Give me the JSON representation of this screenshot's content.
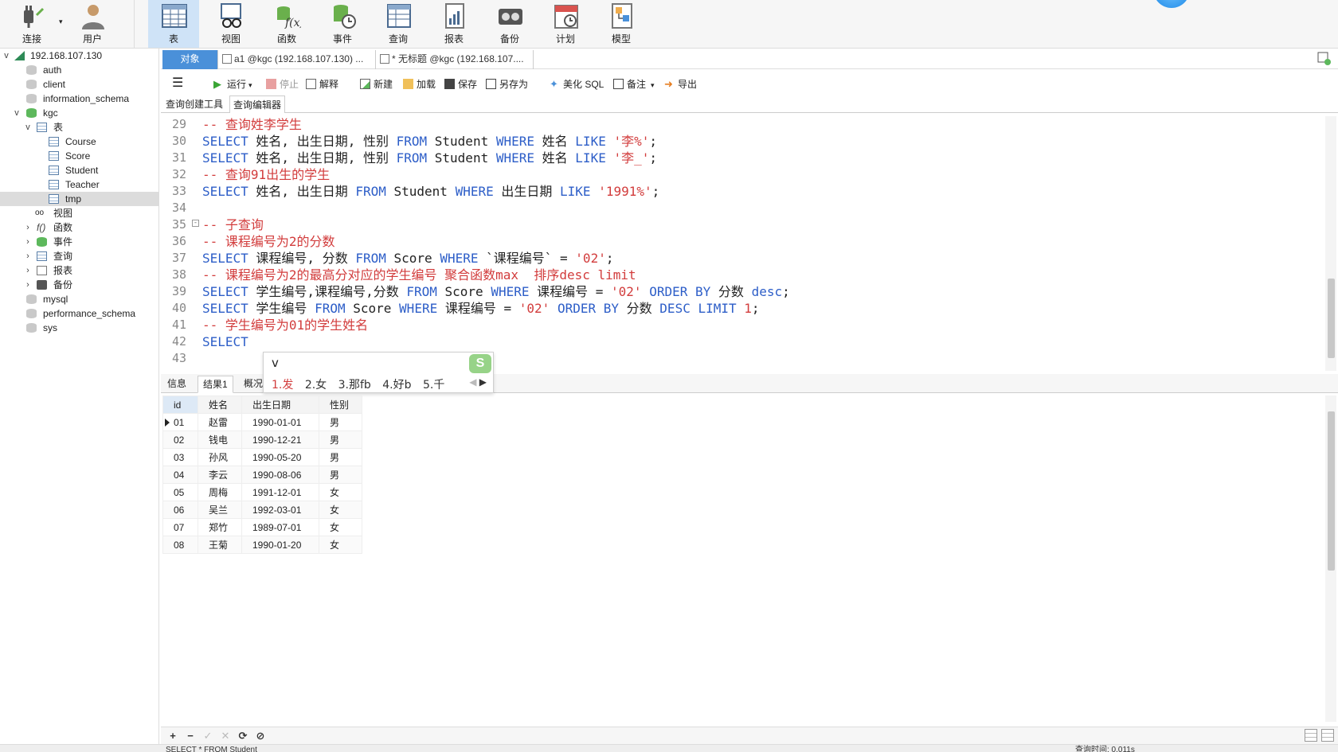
{
  "toolbar": {
    "buttons": [
      {
        "label": "连接"
      },
      {
        "label": "用户"
      },
      {
        "label": "表"
      },
      {
        "label": "视图"
      },
      {
        "label": "函数"
      },
      {
        "label": "事件"
      },
      {
        "label": "查询"
      },
      {
        "label": "报表"
      },
      {
        "label": "备份"
      },
      {
        "label": "计划"
      },
      {
        "label": "模型"
      }
    ]
  },
  "sidebar": {
    "connection": "192.168.107.130",
    "databases_top": [
      "auth",
      "client",
      "information_schema"
    ],
    "kgc": {
      "name": "kgc",
      "tables_label": "表",
      "tables": [
        "Course",
        "Score",
        "Student",
        "Teacher",
        "tmp"
      ],
      "selected_table": "tmp",
      "groups": [
        "视图",
        "函数",
        "事件",
        "查询",
        "报表",
        "备份"
      ]
    },
    "databases_bottom": [
      "mysql",
      "performance_schema",
      "sys"
    ]
  },
  "tabs": [
    {
      "label": "对象"
    },
    {
      "label": "a1 @kgc (192.168.107.130) ..."
    },
    {
      "label": "* 无标题 @kgc (192.168.107...."
    }
  ],
  "query_toolbar": {
    "run": "运行",
    "stop": "停止",
    "explain": "解释",
    "new": "新建",
    "load": "加载",
    "save": "保存",
    "save_as": "另存为",
    "beautify": "美化 SQL",
    "comment": "备注",
    "export": "导出"
  },
  "subtabs": {
    "builder": "查询创建工具",
    "editor": "查询编辑器"
  },
  "editor": {
    "lines": [
      {
        "n": "29",
        "c": "-- 查询姓李学生"
      },
      {
        "n": "30",
        "c": "SELECT 姓名, 出生日期, 性别 FROM Student WHERE 姓名 LIKE '李%';"
      },
      {
        "n": "31",
        "c": "SELECT 姓名, 出生日期, 性别 FROM Student WHERE 姓名 LIKE '李_';"
      },
      {
        "n": "32",
        "c": "-- 查询91出生的学生"
      },
      {
        "n": "33",
        "c": "SELECT 姓名, 出生日期 FROM Student WHERE 出生日期 LIKE '1991%';"
      },
      {
        "n": "34",
        "c": ""
      },
      {
        "n": "35",
        "c": "-- 子查询"
      },
      {
        "n": "36",
        "c": "-- 课程编号为2的分数"
      },
      {
        "n": "37",
        "c": "SELECT 课程编号, 分数 FROM Score WHERE `课程编号` = '02';"
      },
      {
        "n": "38",
        "c": "-- 课程编号为2的最高分对应的学生编号 聚合函数max  排序desc limit"
      },
      {
        "n": "39",
        "c": "SELECT 学生编号,课程编号,分数 FROM Score WHERE 课程编号 = '02' ORDER BY 分数 desc;"
      },
      {
        "n": "40",
        "c": "SELECT 学生编号 FROM Score WHERE 课程编号 = '02' ORDER BY 分数 DESC LIMIT 1;"
      },
      {
        "n": "41",
        "c": "-- 学生编号为01的学生姓名"
      },
      {
        "n": "42",
        "c": "SELECT"
      },
      {
        "n": "43",
        "c": ""
      }
    ]
  },
  "ime": {
    "input": "v",
    "logo": "S",
    "candidates": [
      "1.发",
      "2.女",
      "3.那fb",
      "4.好b",
      "5.千"
    ]
  },
  "result_tabs": {
    "info": "信息",
    "result1": "结果1",
    "profile": "概况"
  },
  "result": {
    "columns": [
      "id",
      "姓名",
      "出生日期",
      "性别"
    ],
    "rows": [
      [
        "01",
        "赵雷",
        "1990-01-01",
        "男"
      ],
      [
        "02",
        "钱电",
        "1990-12-21",
        "男"
      ],
      [
        "03",
        "孙风",
        "1990-05-20",
        "男"
      ],
      [
        "04",
        "李云",
        "1990-08-06",
        "男"
      ],
      [
        "05",
        "周梅",
        "1991-12-01",
        "女"
      ],
      [
        "06",
        "吴兰",
        "1992-03-01",
        "女"
      ],
      [
        "07",
        "郑竹",
        "1989-07-01",
        "女"
      ],
      [
        "08",
        "王菊",
        "1990-01-20",
        "女"
      ]
    ]
  },
  "bottombar": {
    "add": "+",
    "remove": "−",
    "apply": "✓",
    "discard": "✕",
    "refresh": "⟳",
    "stop": "⊘"
  },
  "status": {
    "sql": "SELECT * FROM Student",
    "query_time": "查询时间: 0.011s"
  },
  "colors": {
    "keyword": "#2d5ec8",
    "string": "#d23c3c",
    "comment": "#d23c3c",
    "active_tab": "#4a90d9"
  }
}
